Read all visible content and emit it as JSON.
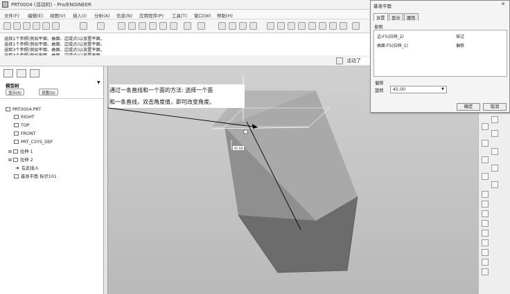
{
  "window": {
    "title": "PRT0004 (活动的) - Pro/ENGINEER"
  },
  "menu": [
    "文件(F)",
    "编辑(E)",
    "视图(V)",
    "插入(I)",
    "分析(A)",
    "信息(N)",
    "应用程序(P)",
    "工具(T)",
    "窗口(W)",
    "帮助(H)"
  ],
  "messages": [
    "选择1个参照(例如平面、曲面、边或点)以放置平面。",
    "选择1个参照(例如平面、曲面、边或点)以放置平面。",
    "选取3个参照(例如平面、曲面、边或点)以放置平面。",
    "选取3个参照(例如平面、曲面、边或点)以放置平面。"
  ],
  "status": {
    "text": "活动了"
  },
  "left_panel": {
    "tree_label": "模型树",
    "show_button": "显示(S)",
    "settings_button": "设置(G)",
    "items": [
      {
        "label": "PRT0004.PRT",
        "icon": "part-icon"
      },
      {
        "label": "RIGHT",
        "icon": "datum-plane-icon"
      },
      {
        "label": "TOP",
        "icon": "datum-plane-icon"
      },
      {
        "label": "FRONT",
        "icon": "datum-plane-icon"
      },
      {
        "label": "PRT_CSYS_DEF",
        "icon": "csys-icon"
      },
      {
        "label": "拉伸 1",
        "icon": "extrude-icon"
      },
      {
        "label": "拉伸 2",
        "icon": "extrude-icon"
      },
      {
        "label": "在此插入",
        "icon": "insert-arrow-icon"
      },
      {
        "label": "基准平面 标识101",
        "icon": "datum-plane-icon"
      }
    ]
  },
  "viewport": {
    "annotation_line1": "通过一条直线和一个面的方法: 选择一个面",
    "annotation_line2": "和一条直线，双击角度值，即可改变角度。",
    "dimension_label": "45.00"
  },
  "dialog": {
    "title": "基准平面",
    "tabs": [
      "放置",
      "显示",
      "属性"
    ],
    "ref_label": "参照",
    "references": [
      {
        "name": "边:F5(拉伸_2)",
        "constraint": "穿过"
      },
      {
        "name": "曲面:F5(拉伸_1)",
        "constraint": "偏移"
      }
    ],
    "offset_label": "偏移",
    "rotation_label": "旋转",
    "rotation_value": "45.00",
    "ok_button": "确定",
    "cancel_button": "取消"
  },
  "colors": {
    "viewport_bg": "#c4c4c4",
    "face_dark": "#6a6a6a",
    "face_mid": "#8c8c8c",
    "face_light": "#a8a8a8"
  }
}
